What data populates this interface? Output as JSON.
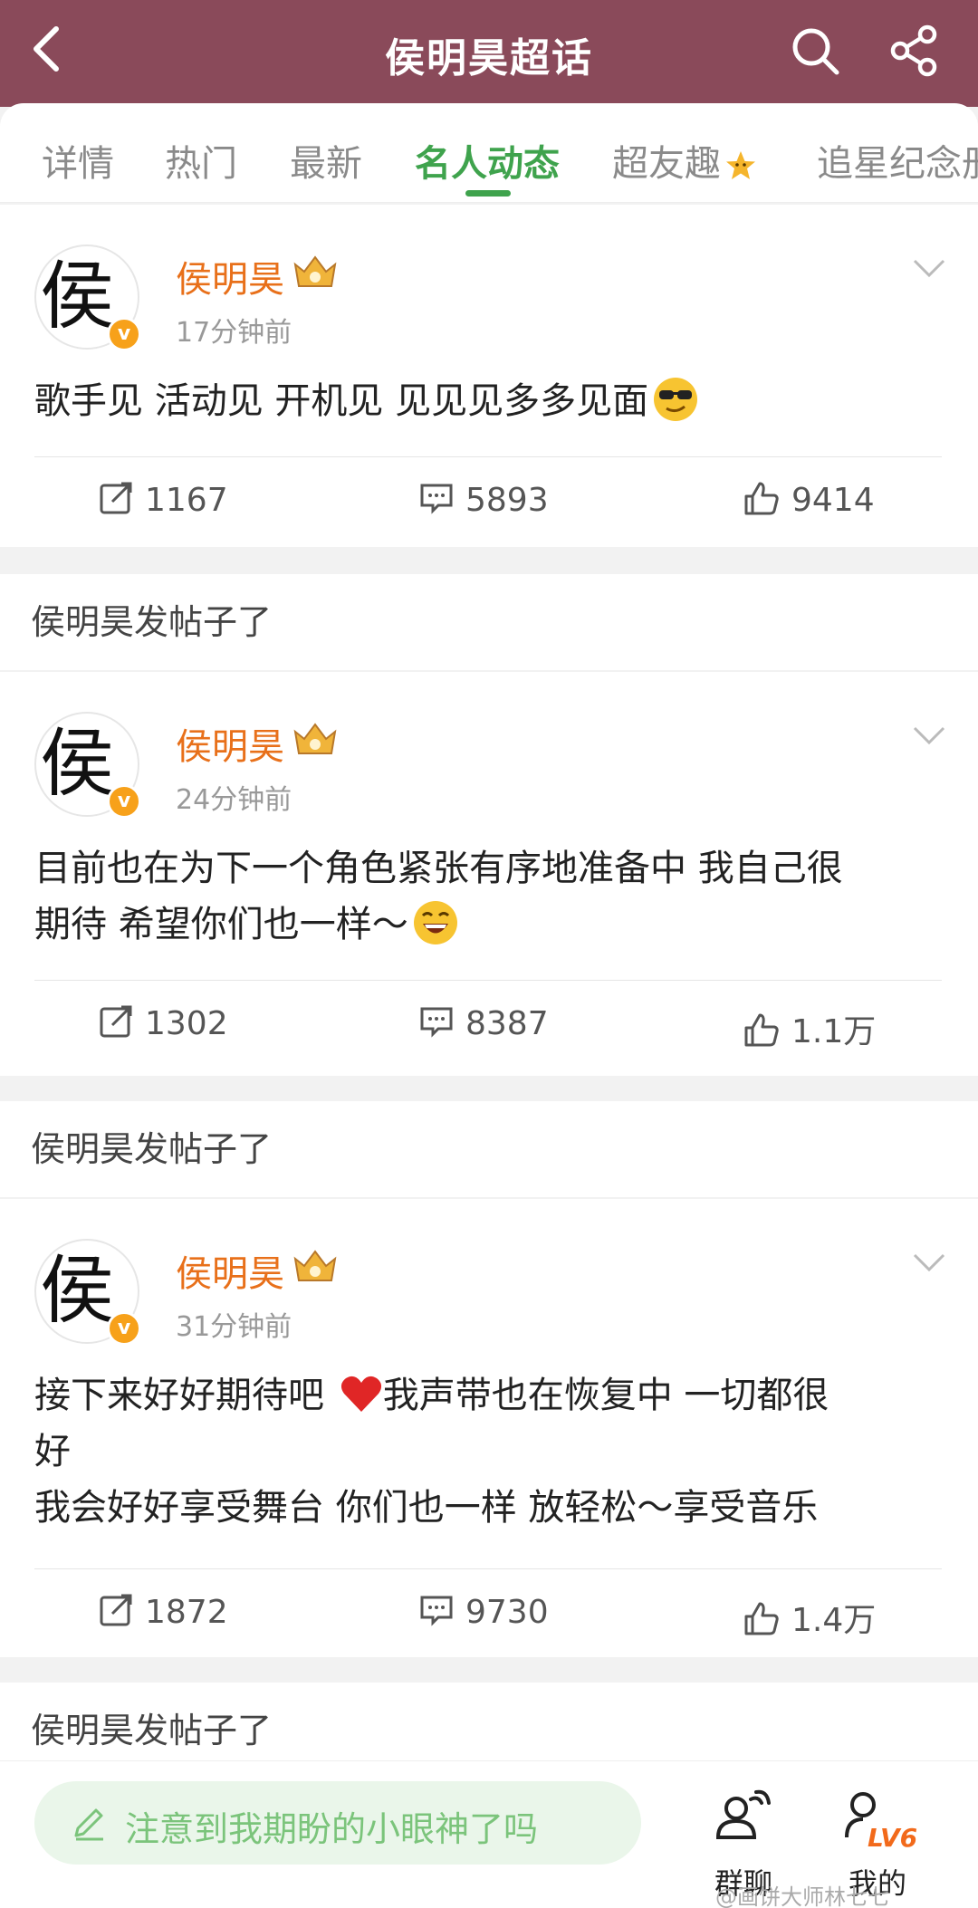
{
  "header": {
    "title": "侯明昊超话"
  },
  "tabs": [
    {
      "label": "详情"
    },
    {
      "label": "热门"
    },
    {
      "label": "最新"
    },
    {
      "label": "名人动态",
      "active": true
    },
    {
      "label": "超友趣"
    },
    {
      "label": "追星纪念册"
    }
  ],
  "posts": [
    {
      "avatar_char": "侯",
      "name": "侯明昊",
      "time": "17分钟前",
      "content_lines": [
        "歌手见  活动见  开机见  见见见多多见面"
      ],
      "emoji": "cool-sunglasses-emoji",
      "reposts": "1167",
      "comments": "5893",
      "likes": "9414"
    },
    {
      "avatar_char": "侯",
      "name": "侯明昊",
      "time": "24分钟前",
      "content_lines": [
        "目前也在为下一个角色紧张有序地准备中  我自己很",
        "期待  希望你们也一样～"
      ],
      "emoji": "laughing-emoji",
      "reposts": "1302",
      "comments": "8387",
      "likes": "1.1万"
    },
    {
      "avatar_char": "侯",
      "name": "侯明昊",
      "time": "31分钟前",
      "content_lines": [
        "接下来好好期待吧 ",
        "我声带也在恢复中  一切都很",
        "好",
        "我会好好享受舞台   你们也一样  放轻松～享受音乐"
      ],
      "emoji": "red-heart-emoji",
      "reposts": "1872",
      "comments": "9730",
      "likes": "1.4万"
    }
  ],
  "section_label": "侯明昊发帖子了",
  "bottom": {
    "compose_placeholder": "注意到我期盼的小眼神了吗",
    "group_chat_label": "群聊",
    "mine_label": "我的",
    "level_badge": "LV6"
  },
  "watermark": "@画饼大师林七七",
  "colors": {
    "header_bg": "#8a4a5a",
    "accent_green": "#3fa34d",
    "name_orange": "#e8701a"
  }
}
